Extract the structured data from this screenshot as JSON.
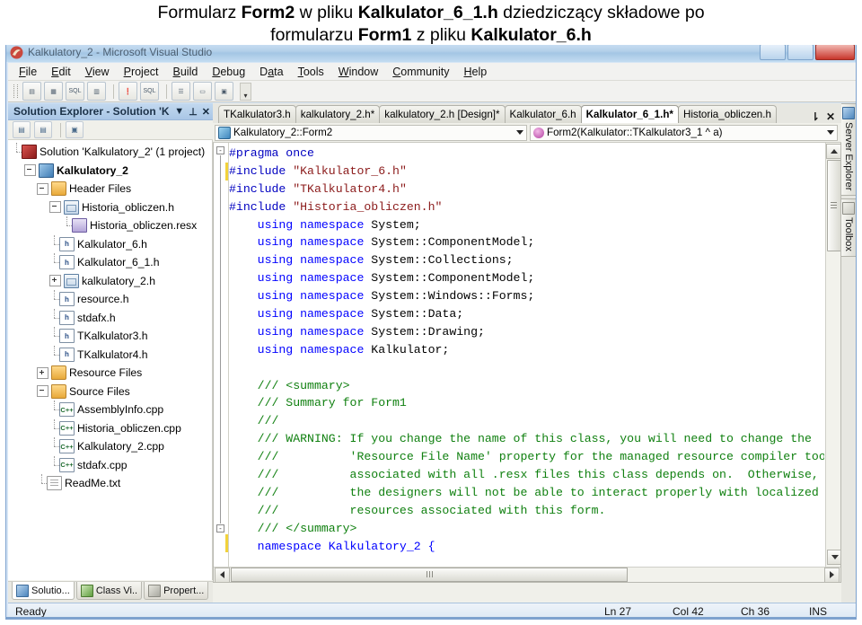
{
  "caption": {
    "line1_part1": "Formularz ",
    "line1_bold1": "Form2",
    "line1_part2": " w pliku ",
    "line1_bold2": "Kalkulator_6_1.h",
    "line1_part3": " dziedziczący składowe po",
    "line2_part1": "formularzu ",
    "line2_bold1": "Form1",
    "line2_part2": " z pliku ",
    "line2_bold2": "Kalkulator_6.h"
  },
  "window": {
    "title": "Kalkulatory_2 - Microsoft Visual Studio",
    "app_icon": "visual-studio-icon",
    "minimize_label": "",
    "maximize_label": "",
    "close_label": ""
  },
  "menu": {
    "items": [
      {
        "label": "File",
        "accel": "F"
      },
      {
        "label": "Edit",
        "accel": "E"
      },
      {
        "label": "View",
        "accel": "V"
      },
      {
        "label": "Project",
        "accel": "P"
      },
      {
        "label": "Build",
        "accel": "B"
      },
      {
        "label": "Debug",
        "accel": "D"
      },
      {
        "label": "Data",
        "accel": "a"
      },
      {
        "label": "Tools",
        "accel": "T"
      },
      {
        "label": "Window",
        "accel": "W"
      },
      {
        "label": "Community",
        "accel": "C"
      },
      {
        "label": "Help",
        "accel": "H"
      }
    ]
  },
  "toolbar": {
    "buttons": [
      {
        "name": "new-query-icon",
        "glyph": "▤"
      },
      {
        "name": "table-icon",
        "glyph": "▦"
      },
      {
        "name": "sql-icon",
        "glyph": "SQL"
      },
      {
        "name": "database-icon",
        "glyph": "▥"
      },
      {
        "name": "execute-icon",
        "glyph": "❗"
      },
      {
        "name": "verify-sql-icon",
        "glyph": "SQL"
      },
      {
        "name": "outline-icon",
        "glyph": "☰"
      },
      {
        "name": "properties-icon",
        "glyph": "▭"
      },
      {
        "name": "form-icon",
        "glyph": "▣"
      }
    ],
    "overflow_glyph": "▾"
  },
  "solution_explorer": {
    "title": "Solution Explorer - Solution 'K...",
    "dropdown_glyph": "▼",
    "pin_glyph": "⊥",
    "close_glyph": "✕",
    "toolbar_buttons": [
      {
        "name": "properties-page-icon",
        "glyph": "▤"
      },
      {
        "name": "show-all-files-icon",
        "glyph": "▤"
      },
      {
        "name": "view-code-icon",
        "glyph": "▣"
      }
    ],
    "tree": [
      {
        "label": "Solution 'Kalkulatory_2' (1 project)",
        "icon": "solution-icon",
        "indent": 0,
        "expander": "none",
        "bold": false
      },
      {
        "label": "Kalkulatory_2",
        "icon": "project-icon",
        "indent": 1,
        "expander": "minus",
        "bold": true
      },
      {
        "label": "Header Files",
        "icon": "folder-icon",
        "indent": 2,
        "expander": "minus",
        "bold": false
      },
      {
        "label": "Historia_obliczen.h",
        "icon": "form-header-icon",
        "indent": 3,
        "expander": "minus",
        "bold": false
      },
      {
        "label": "Historia_obliczen.resx",
        "icon": "resx-icon",
        "indent": 4,
        "expander": "none",
        "bold": false
      },
      {
        "label": "Kalkulator_6.h",
        "icon": "header-icon",
        "indent": 3,
        "expander": "none",
        "bold": false
      },
      {
        "label": "Kalkulator_6_1.h",
        "icon": "header-icon",
        "indent": 3,
        "expander": "none",
        "bold": false
      },
      {
        "label": "kalkulatory_2.h",
        "icon": "form-header-icon",
        "indent": 3,
        "expander": "plus",
        "bold": false
      },
      {
        "label": "resource.h",
        "icon": "header-icon",
        "indent": 3,
        "expander": "none",
        "bold": false
      },
      {
        "label": "stdafx.h",
        "icon": "header-icon",
        "indent": 3,
        "expander": "none",
        "bold": false
      },
      {
        "label": "TKalkulator3.h",
        "icon": "header-icon",
        "indent": 3,
        "expander": "none",
        "bold": false
      },
      {
        "label": "TKalkulator4.h",
        "icon": "header-icon",
        "indent": 3,
        "expander": "none",
        "bold": false
      },
      {
        "label": "Resource Files",
        "icon": "folder-icon",
        "indent": 2,
        "expander": "plus",
        "bold": false
      },
      {
        "label": "Source Files",
        "icon": "folder-icon",
        "indent": 2,
        "expander": "minus",
        "bold": false
      },
      {
        "label": "AssemblyInfo.cpp",
        "icon": "cpp-icon",
        "indent": 3,
        "expander": "none",
        "bold": false
      },
      {
        "label": "Historia_obliczen.cpp",
        "icon": "cpp-icon",
        "indent": 3,
        "expander": "none",
        "bold": false
      },
      {
        "label": "Kalkulatory_2.cpp",
        "icon": "cpp-icon",
        "indent": 3,
        "expander": "none",
        "bold": false
      },
      {
        "label": "stdafx.cpp",
        "icon": "cpp-icon",
        "indent": 3,
        "expander": "none",
        "bold": false
      },
      {
        "label": "ReadMe.txt",
        "icon": "text-file-icon",
        "indent": 2,
        "expander": "none",
        "bold": false
      }
    ],
    "bottom_tabs": [
      {
        "label": "Solutio...",
        "icon": "solution-explorer-icon",
        "active": true
      },
      {
        "label": "Class Vi..",
        "icon": "class-view-icon",
        "active": false
      },
      {
        "label": "Propert...",
        "icon": "properties-icon",
        "active": false
      }
    ]
  },
  "editor": {
    "document_tabs": [
      {
        "label": "TKalkulator3.h",
        "active": false
      },
      {
        "label": "kalkulatory_2.h*",
        "active": false
      },
      {
        "label": "kalkulatory_2.h [Design]*",
        "active": false
      },
      {
        "label": "Kalkulator_6.h",
        "active": false
      },
      {
        "label": "Kalkulator_6_1.h*",
        "active": true
      },
      {
        "label": "Historia_obliczen.h",
        "active": false
      }
    ],
    "tab_list_glyph": "⇂",
    "tab_close_glyph": "✕",
    "nav_left": "Kalkulatory_2::Form2",
    "nav_right": "Form2(Kalkulator::TKalkulator3_1 ^ a)",
    "code_lines": [
      [
        {
          "t": "#pragma once",
          "c": "pre"
        }
      ],
      [
        {
          "t": "#include ",
          "c": "pre"
        },
        {
          "t": "\"Kalkulator_6.h\"",
          "c": "str"
        }
      ],
      [
        {
          "t": "#include ",
          "c": "pre"
        },
        {
          "t": "\"TKalkulator4.h\"",
          "c": "str"
        }
      ],
      [
        {
          "t": "#include ",
          "c": "pre"
        },
        {
          "t": "\"Historia_obliczen.h\"",
          "c": "str"
        }
      ],
      [
        {
          "t": "    ",
          "c": "id"
        },
        {
          "t": "using namespace ",
          "c": "key"
        },
        {
          "t": "System;",
          "c": "id"
        }
      ],
      [
        {
          "t": "    ",
          "c": "id"
        },
        {
          "t": "using namespace ",
          "c": "key"
        },
        {
          "t": "System::ComponentModel;",
          "c": "id"
        }
      ],
      [
        {
          "t": "    ",
          "c": "id"
        },
        {
          "t": "using namespace ",
          "c": "key"
        },
        {
          "t": "System::Collections;",
          "c": "id"
        }
      ],
      [
        {
          "t": "    ",
          "c": "id"
        },
        {
          "t": "using namespace ",
          "c": "key"
        },
        {
          "t": "System::ComponentModel;",
          "c": "id"
        }
      ],
      [
        {
          "t": "    ",
          "c": "id"
        },
        {
          "t": "using namespace ",
          "c": "key"
        },
        {
          "t": "System::Windows::Forms;",
          "c": "id"
        }
      ],
      [
        {
          "t": "    ",
          "c": "id"
        },
        {
          "t": "using namespace ",
          "c": "key"
        },
        {
          "t": "System::Data;",
          "c": "id"
        }
      ],
      [
        {
          "t": "    ",
          "c": "id"
        },
        {
          "t": "using namespace ",
          "c": "key"
        },
        {
          "t": "System::Drawing;",
          "c": "id"
        }
      ],
      [
        {
          "t": "    ",
          "c": "id"
        },
        {
          "t": "using namespace ",
          "c": "key"
        },
        {
          "t": "Kalkulator;",
          "c": "id"
        }
      ],
      [
        {
          "t": "",
          "c": "id"
        }
      ],
      [
        {
          "t": "    /// <summary>",
          "c": "cmt"
        }
      ],
      [
        {
          "t": "    /// Summary for Form1",
          "c": "cmt"
        }
      ],
      [
        {
          "t": "    ///",
          "c": "cmt"
        }
      ],
      [
        {
          "t": "    /// WARNING: If you change the name of this class, you will need to change the",
          "c": "cmt"
        }
      ],
      [
        {
          "t": "    ///          'Resource File Name' property for the managed resource compiler tool",
          "c": "cmt"
        }
      ],
      [
        {
          "t": "    ///          associated with all .resx files this class depends on.  Otherwise,",
          "c": "cmt"
        }
      ],
      [
        {
          "t": "    ///          the designers will not be able to interact properly with localized",
          "c": "cmt"
        }
      ],
      [
        {
          "t": "    ///          resources associated with this form.",
          "c": "cmt"
        }
      ],
      [
        {
          "t": "    /// </summary>",
          "c": "cmt"
        }
      ],
      [
        {
          "t": "    namespace Kalkulatory_2 {",
          "c": "key"
        }
      ]
    ],
    "fold_collapse_glyph": "-",
    "fold_expand_glyph": "+"
  },
  "right_tabs": [
    {
      "label": "Server Explorer",
      "icon": "server-explorer-icon"
    },
    {
      "label": "Toolbox",
      "icon": "toolbox-icon"
    }
  ],
  "status_bar": {
    "message": "Ready",
    "line": "Ln 27",
    "column": "Col 42",
    "character": "Ch 36",
    "insert_mode": "INS"
  },
  "colors": {
    "title_bar": "#b3d0ea",
    "panel_header": "#a9c6e6",
    "preprocessor": "#0000c0",
    "string": "#8b1a1a",
    "keyword": "#0000ff",
    "comment": "#108010",
    "status_bar": "#dce8f4"
  }
}
